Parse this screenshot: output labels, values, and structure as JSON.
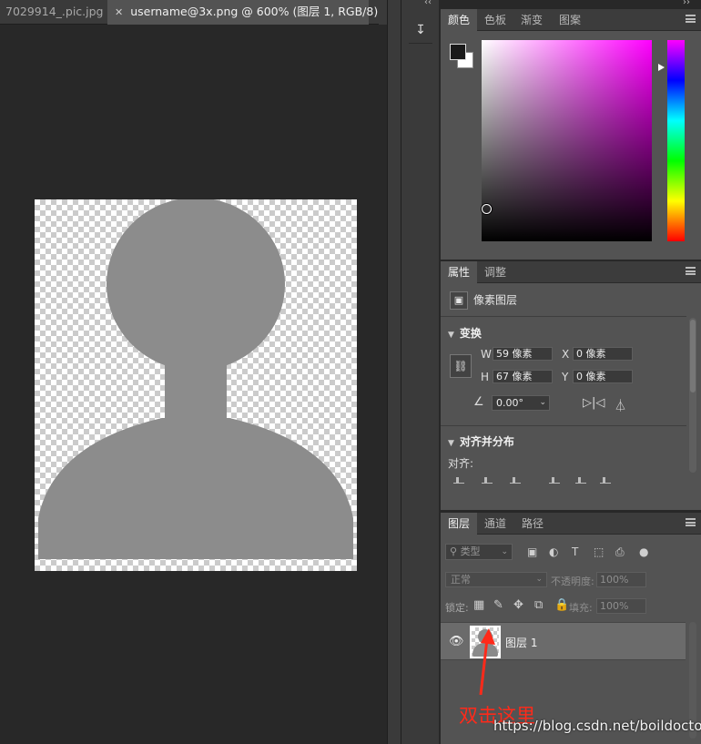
{
  "document_tabs": [
    {
      "label": "7029914_.pic.jpg",
      "active": false
    },
    {
      "label": "username@3x.png @ 600% (图层 1, RGB/8)",
      "active": true
    }
  ],
  "tab_overflow_icon": "double-chevron-right-icon",
  "color_panel": {
    "tabs": [
      "颜色",
      "色板",
      "渐变",
      "图案"
    ],
    "active_tab": "颜色",
    "foreground_color": "#1a1a1a",
    "background_color": "#ffffff",
    "hue_color": "#ff00ff"
  },
  "properties_panel": {
    "tabs": [
      "属性",
      "调整"
    ],
    "active_tab": "属性",
    "layer_kind": "像素图层",
    "transform_section": "变换",
    "w_label": "W",
    "w_value": "59 像素",
    "h_label": "H",
    "h_value": "67 像素",
    "x_label": "X",
    "x_value": "0 像素",
    "y_label": "Y",
    "y_value": "0 像素",
    "angle_value": "0.00°",
    "align_section": "对齐并分布",
    "align_label": "对齐:"
  },
  "layers_panel": {
    "tabs": [
      "图层",
      "通道",
      "路径"
    ],
    "active_tab": "图层",
    "filter_placeholder": "类型",
    "blend_mode": "正常",
    "opacity_label": "不透明度:",
    "opacity_value": "100%",
    "lock_label": "锁定:",
    "fill_label": "填充:",
    "fill_value": "100%",
    "layers": [
      {
        "name": "图层 1",
        "visible": true
      }
    ]
  },
  "annotation": {
    "text": "双击这里",
    "color": "#ff2a1a"
  },
  "watermark": "https://blog.csdn.net/boildoctor"
}
